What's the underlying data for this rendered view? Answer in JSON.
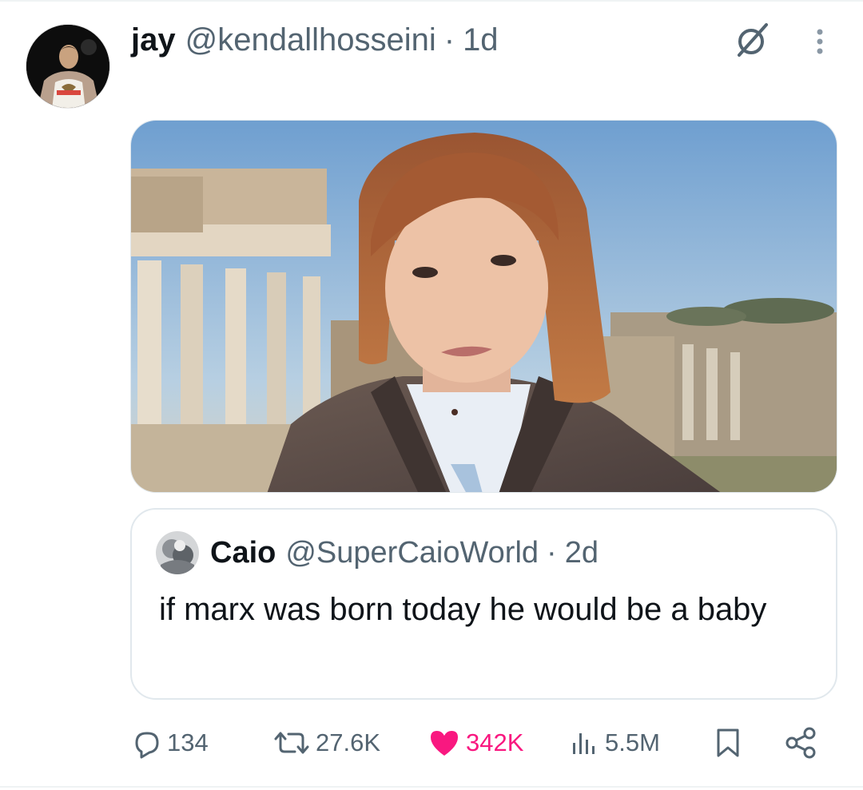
{
  "tweet": {
    "author_name": "jay",
    "handle": "@kendallhosseini",
    "separator": "·",
    "time": "1d"
  },
  "quote": {
    "author_name": "Caio",
    "handle": "@SuperCaioWorld",
    "separator": "·",
    "time": "2d",
    "text": "if marx was born today he would be a baby"
  },
  "actions": {
    "replies": "134",
    "reposts": "27.6K",
    "likes": "342K",
    "views": "5.5M"
  },
  "icons": {
    "grok": "grok-icon",
    "more": "more-icon",
    "reply": "reply-icon",
    "repost": "repost-icon",
    "like": "heart-icon",
    "views": "views-icon",
    "bookmark": "bookmark-icon",
    "share": "share-icon"
  },
  "colors": {
    "text": "#0f1419",
    "secondary": "#536471",
    "like": "#f91880",
    "border": "#e1e8ed"
  }
}
